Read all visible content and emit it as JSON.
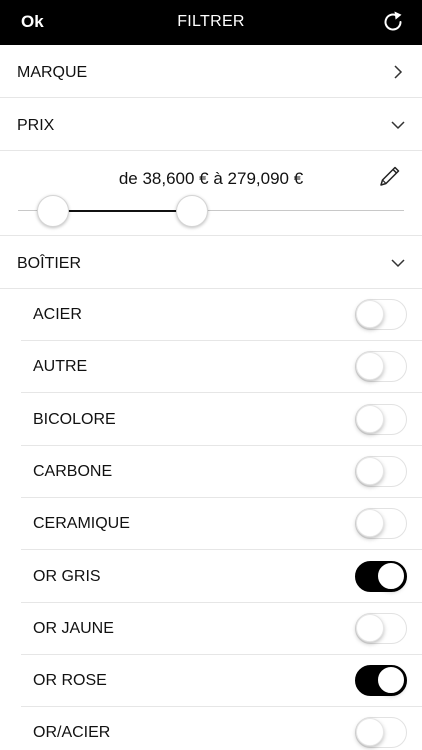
{
  "header": {
    "ok_label": "Ok",
    "title": "FILTRER",
    "refresh_icon": "refresh-icon"
  },
  "sections": {
    "marque": {
      "label": "MARQUE",
      "icon": "chevron-right-icon"
    },
    "prix": {
      "label": "PRIX",
      "icon": "chevron-down-icon"
    },
    "boitier": {
      "label": "BOÎTIER",
      "icon": "chevron-down-icon"
    }
  },
  "price": {
    "text": "de 38,600 € à 279,090 €",
    "min_selected": 38600,
    "max_selected": 279090,
    "slider_low_fraction": 0.09,
    "slider_high_fraction": 0.45,
    "edit_icon": "pencil-icon"
  },
  "case_options": [
    {
      "label": "ACIER",
      "on": false
    },
    {
      "label": "AUTRE",
      "on": false
    },
    {
      "label": "BICOLORE",
      "on": false
    },
    {
      "label": "CARBONE",
      "on": false
    },
    {
      "label": "CERAMIQUE",
      "on": false
    },
    {
      "label": "OR GRIS",
      "on": true
    },
    {
      "label": "OR JAUNE",
      "on": false
    },
    {
      "label": "OR ROSE",
      "on": true
    },
    {
      "label": "OR/ACIER",
      "on": false
    }
  ]
}
